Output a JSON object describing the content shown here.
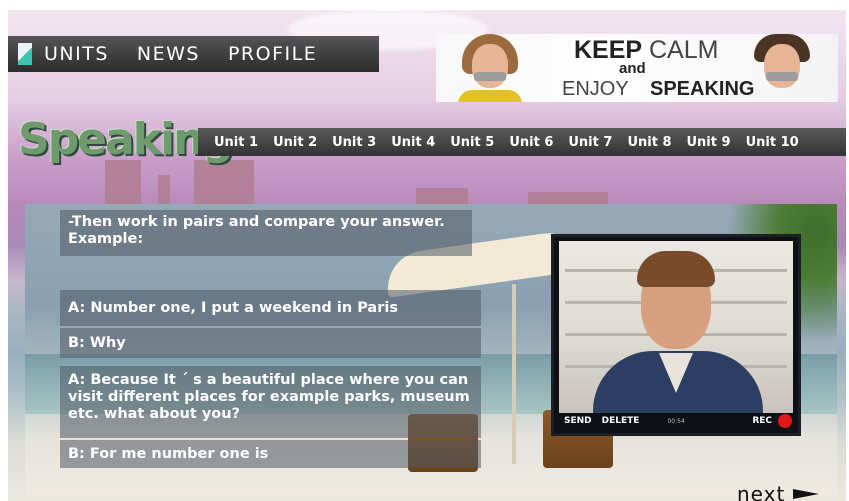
{
  "nav": {
    "items": [
      "UNITS",
      "NEWS",
      "PROFILE"
    ]
  },
  "banner": {
    "keep": "KEEP",
    "calm": "CALM",
    "and": "and",
    "enjoy": "ENJOY",
    "speaking": "SPEAKING"
  },
  "section_title": "Speaking",
  "units": [
    "Unit 1",
    "Unit 2",
    "Unit 3",
    "Unit 4",
    "Unit 5",
    "Unit 6",
    "Unit 7",
    "Unit 8",
    "Unit 9",
    "Unit 10"
  ],
  "exercise": {
    "instruction": "-Then work in pairs and compare your answer. Example:",
    "line_a1": "A:   Number one, I put a weekend in Paris",
    "line_b1": "B: Why",
    "line_a2": "A: Because It ´ s a beautiful place where you can visit different places for example parks, museum etc.   what about you?",
    "line_b2": "B: For me number one is"
  },
  "video": {
    "send": "SEND",
    "delete": "DELETE",
    "time": "00:54",
    "rec": "REC",
    "rec_color": "#e3161c"
  },
  "next_label": "next",
  "colors": {
    "nav_bg": "#333333",
    "title_green": "#6f9a6e",
    "accent_teal": "#3fc1b3"
  }
}
